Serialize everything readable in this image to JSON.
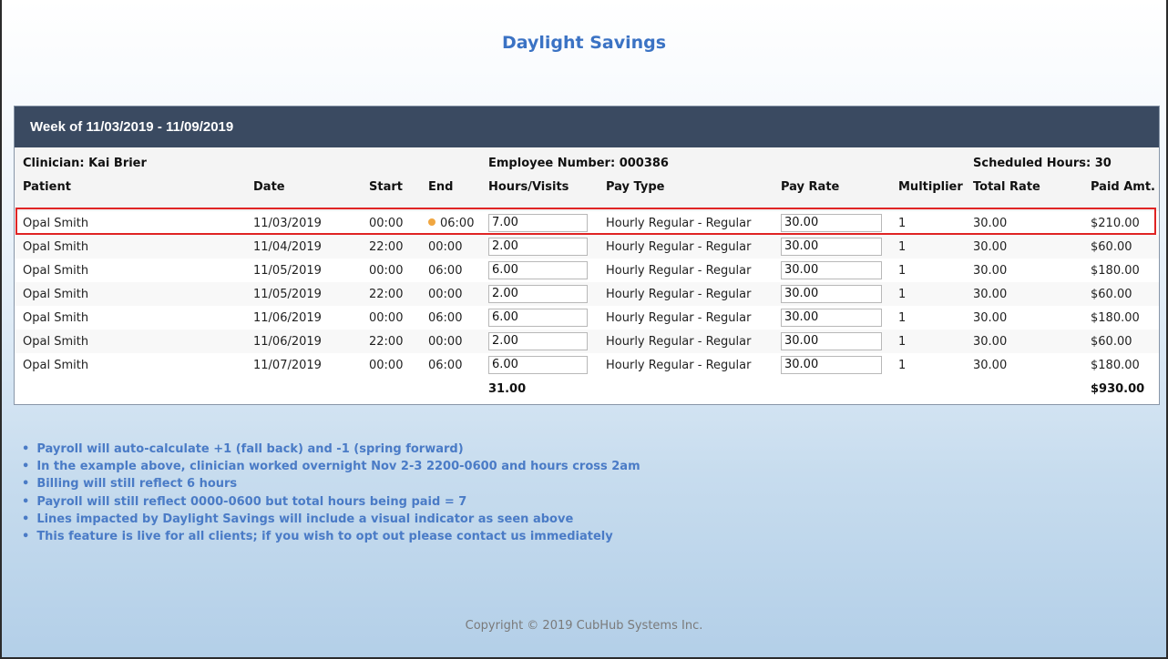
{
  "title": "Daylight Savings",
  "week_label": "Week of 11/03/2019 - 11/09/2019",
  "clinician": "Clinician: Kai Brier",
  "employee_number": "Employee Number: 000386",
  "scheduled_hours": "Scheduled Hours: 30",
  "columns": [
    "Patient",
    "Date",
    "Start",
    "End",
    "Hours/Visits",
    "Pay Type",
    "Pay Rate",
    "Multiplier",
    "Total Rate",
    "Paid Amt."
  ],
  "rows": [
    {
      "patient": "Opal Smith",
      "date": "11/03/2019",
      "start": "00:00",
      "end": "06:00",
      "hours": "7.00",
      "pay_type": "Hourly Regular - Regular",
      "pay_rate": "30.00",
      "multiplier": "1",
      "total_rate": "30.00",
      "paid": "$210.00",
      "dst": true
    },
    {
      "patient": "Opal Smith",
      "date": "11/04/2019",
      "start": "22:00",
      "end": "00:00",
      "hours": "2.00",
      "pay_type": "Hourly Regular - Regular",
      "pay_rate": "30.00",
      "multiplier": "1",
      "total_rate": "30.00",
      "paid": "$60.00",
      "dst": false
    },
    {
      "patient": "Opal Smith",
      "date": "11/05/2019",
      "start": "00:00",
      "end": "06:00",
      "hours": "6.00",
      "pay_type": "Hourly Regular - Regular",
      "pay_rate": "30.00",
      "multiplier": "1",
      "total_rate": "30.00",
      "paid": "$180.00",
      "dst": false
    },
    {
      "patient": "Opal Smith",
      "date": "11/05/2019",
      "start": "22:00",
      "end": "00:00",
      "hours": "2.00",
      "pay_type": "Hourly Regular - Regular",
      "pay_rate": "30.00",
      "multiplier": "1",
      "total_rate": "30.00",
      "paid": "$60.00",
      "dst": false
    },
    {
      "patient": "Opal Smith",
      "date": "11/06/2019",
      "start": "00:00",
      "end": "06:00",
      "hours": "6.00",
      "pay_type": "Hourly Regular - Regular",
      "pay_rate": "30.00",
      "multiplier": "1",
      "total_rate": "30.00",
      "paid": "$180.00",
      "dst": false
    },
    {
      "patient": "Opal Smith",
      "date": "11/06/2019",
      "start": "22:00",
      "end": "00:00",
      "hours": "2.00",
      "pay_type": "Hourly Regular - Regular",
      "pay_rate": "30.00",
      "multiplier": "1",
      "total_rate": "30.00",
      "paid": "$60.00",
      "dst": false
    },
    {
      "patient": "Opal Smith",
      "date": "11/07/2019",
      "start": "00:00",
      "end": "06:00",
      "hours": "6.00",
      "pay_type": "Hourly Regular - Regular",
      "pay_rate": "30.00",
      "multiplier": "1",
      "total_rate": "30.00",
      "paid": "$180.00",
      "dst": false
    }
  ],
  "totals": {
    "hours": "31.00",
    "paid": "$930.00"
  },
  "notes": [
    "Payroll will auto-calculate +1 (fall back) and -1 (spring forward)",
    "In the example above, clinician worked overnight Nov 2-3 2200-0600 and hours cross 2am",
    "Billing will still reflect 6 hours",
    "Payroll will still reflect 0000-0600 but total hours being paid = 7",
    "Lines impacted by Daylight Savings will include a visual indicator as seen above",
    "This feature is live for all clients; if you wish to opt out please contact us immediately"
  ],
  "copyright": "Copyright © 2019 CubHub Systems Inc.",
  "colors": {
    "header_bg": "#3a4a61",
    "title": "#3b73c4",
    "dst_indicator": "#f0a640",
    "highlight": "#e02424"
  },
  "icons": {
    "dst_indicator": "dst-indicator-dot-icon"
  }
}
